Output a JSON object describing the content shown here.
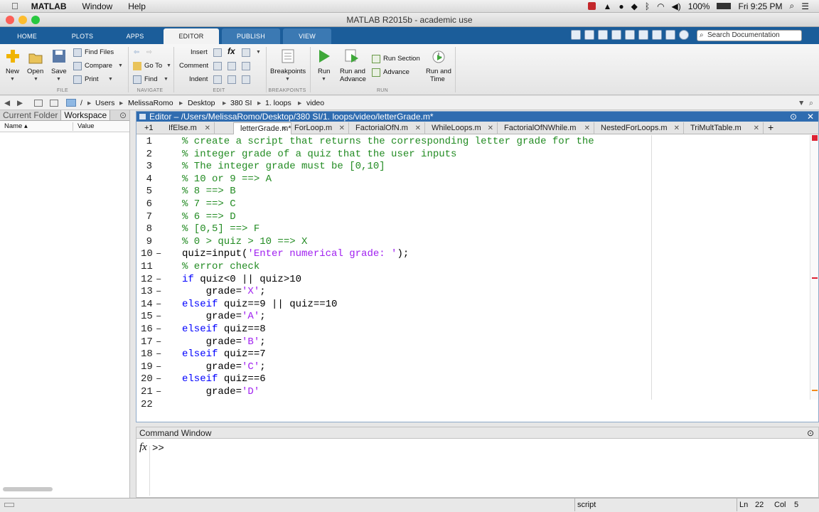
{
  "menubar": {
    "app": "MATLAB",
    "items": [
      "Window",
      "Help"
    ],
    "battery": "100%",
    "time": "Fri 9:25 PM"
  },
  "window": {
    "title": "MATLAB R2015b - academic use"
  },
  "ribbon_tabs": [
    "HOME",
    "PLOTS",
    "APPS",
    "EDITOR",
    "PUBLISH",
    "VIEW"
  ],
  "search_placeholder": "Search Documentation",
  "ribbon": {
    "new": "New",
    "open": "Open",
    "save": "Save",
    "find_files": "Find Files",
    "compare": "Compare",
    "print": "Print",
    "go_to": "Go To",
    "find": "Find",
    "insert": "Insert",
    "comment": "Comment",
    "indent": "Indent",
    "breakpoints": "Breakpoints",
    "run": "Run",
    "run_and_advance_1": "Run and",
    "run_and_advance_2": "Advance",
    "run_section": "Run Section",
    "advance": "Advance",
    "run_and_time_1": "Run and",
    "run_and_time_2": "Time",
    "sections": [
      "FILE",
      "NAVIGATE",
      "EDIT",
      "BREAKPOINTS",
      "RUN"
    ],
    "fx": "fx"
  },
  "address": {
    "path": [
      "/",
      "Users",
      "MelissaRomo",
      "Desktop",
      "380 SI",
      "1. loops",
      "video"
    ]
  },
  "left_panel": {
    "tabs": [
      "Current Folder",
      "Workspace"
    ],
    "col_name": "Name ▴",
    "col_value": "Value"
  },
  "editor": {
    "title": "Editor – /Users/MelissaRomo/Desktop/380 SI/1. loops/video/letterGrade.m*",
    "counter": "+1",
    "tabs": [
      "IfElse.m",
      "letterGrade.m*",
      "ForLoop.m",
      "FactorialOfN.m",
      "WhileLoops.m",
      "FactorialOfNWhile.m",
      "NestedForLoops.m",
      "TriMultTable.m"
    ],
    "add_tab": "+",
    "lines": [
      {
        "n": "1",
        "dash": "",
        "t": [
          [
            "cm",
            "% create a script that returns the corresponding letter grade for the"
          ]
        ]
      },
      {
        "n": "2",
        "dash": "",
        "t": [
          [
            "cm",
            "% integer grade of a quiz that the user inputs"
          ]
        ]
      },
      {
        "n": "3",
        "dash": "",
        "t": [
          [
            "cm",
            "% The integer grade must be [0,10]"
          ]
        ]
      },
      {
        "n": "4",
        "dash": "",
        "t": [
          [
            "cm",
            "% 10 or 9 ==> A"
          ]
        ]
      },
      {
        "n": "5",
        "dash": "",
        "t": [
          [
            "cm",
            "% 8 ==> B"
          ]
        ]
      },
      {
        "n": "6",
        "dash": "",
        "t": [
          [
            "cm",
            "% 7 ==> C"
          ]
        ]
      },
      {
        "n": "7",
        "dash": "",
        "t": [
          [
            "cm",
            "% 6 ==> D"
          ]
        ]
      },
      {
        "n": "8",
        "dash": "",
        "t": [
          [
            "cm",
            "% [0,5] ==> F"
          ]
        ]
      },
      {
        "n": "9",
        "dash": "",
        "t": [
          [
            "cm",
            "% 0 > quiz > 10 ==> X"
          ]
        ]
      },
      {
        "n": "10",
        "dash": "–",
        "t": [
          [
            "",
            "quiz=input("
          ],
          [
            "str",
            "'Enter numerical grade: '"
          ],
          [
            "",
            ");"
          ]
        ]
      },
      {
        "n": "11",
        "dash": "",
        "t": [
          [
            "cm",
            "% error check"
          ]
        ]
      },
      {
        "n": "12",
        "dash": "–",
        "t": [
          [
            "kw",
            "if"
          ],
          [
            "",
            " quiz<0 || quiz>10"
          ]
        ]
      },
      {
        "n": "13",
        "dash": "–",
        "t": [
          [
            "",
            "    grade="
          ],
          [
            "str",
            "'X'"
          ],
          [
            "",
            ";"
          ]
        ]
      },
      {
        "n": "14",
        "dash": "–",
        "t": [
          [
            "kw",
            "elseif"
          ],
          [
            "",
            " quiz==9 || quiz==10"
          ]
        ]
      },
      {
        "n": "15",
        "dash": "–",
        "t": [
          [
            "",
            "    grade="
          ],
          [
            "str",
            "'A'"
          ],
          [
            "",
            ";"
          ]
        ]
      },
      {
        "n": "16",
        "dash": "–",
        "t": [
          [
            "kw",
            "elseif"
          ],
          [
            "",
            " quiz==8"
          ]
        ]
      },
      {
        "n": "17",
        "dash": "–",
        "t": [
          [
            "",
            "    grade="
          ],
          [
            "str",
            "'B'"
          ],
          [
            "",
            ";"
          ]
        ]
      },
      {
        "n": "18",
        "dash": "–",
        "t": [
          [
            "kw",
            "elseif"
          ],
          [
            "",
            " quiz==7"
          ]
        ]
      },
      {
        "n": "19",
        "dash": "–",
        "t": [
          [
            "",
            "    grade="
          ],
          [
            "str",
            "'C'"
          ],
          [
            "",
            ";"
          ]
        ]
      },
      {
        "n": "20",
        "dash": "–",
        "t": [
          [
            "kw",
            "elseif"
          ],
          [
            "",
            " quiz==6"
          ]
        ]
      },
      {
        "n": "21",
        "dash": "–",
        "t": [
          [
            "",
            "    grade="
          ],
          [
            "str",
            "'D'"
          ]
        ]
      },
      {
        "n": "22",
        "dash": "",
        "t": []
      }
    ]
  },
  "command_window": {
    "title": "Command Window",
    "fx": "fx",
    "prompt": ">>"
  },
  "status": {
    "mode": "script",
    "ln_label": "Ln",
    "ln": "22",
    "col_label": "Col",
    "col": "5"
  },
  "colors": {
    "ribbon_blue": "#1b5d9a",
    "editor_title": "#2f6cb0",
    "comment": "#228b22",
    "keyword": "#0000ff",
    "string": "#a020f0"
  }
}
